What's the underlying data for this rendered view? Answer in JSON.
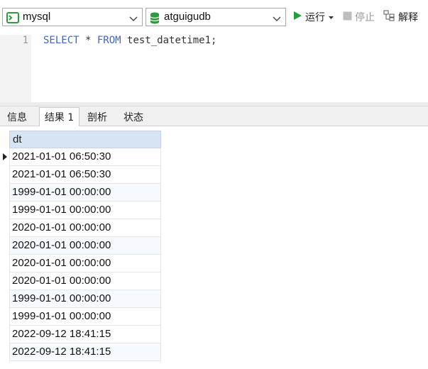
{
  "toolbar": {
    "connection": "mysql",
    "database": "atguigudb",
    "run_label": "运行",
    "stop_label": "停止",
    "explain_label": "解释"
  },
  "editor": {
    "line_number": "1",
    "code_keyword1": "SELECT",
    "code_mid": " * ",
    "code_keyword2": "FROM",
    "code_rest": " test_datetime1;"
  },
  "tabs": [
    "信息",
    "结果 1",
    "剖析",
    "状态"
  ],
  "active_tab": "结果 1",
  "grid": {
    "column": "dt",
    "rows": [
      "2021-01-01 06:50:30",
      "2021-01-01 06:50:30",
      "1999-01-01 00:00:00",
      "1999-01-01 00:00:00",
      "2020-01-01 00:00:00",
      "2020-01-01 00:00:00",
      "2020-01-01 00:00:00",
      "2020-01-01 00:00:00",
      "1999-01-01 00:00:00",
      "1999-01-01 00:00:00",
      "2022-09-12 18:41:15",
      "2022-09-12 18:41:15"
    ]
  },
  "colors": {
    "keyword": "#3b66c9",
    "run": "#22a03a",
    "header": "#d6e4f3"
  }
}
